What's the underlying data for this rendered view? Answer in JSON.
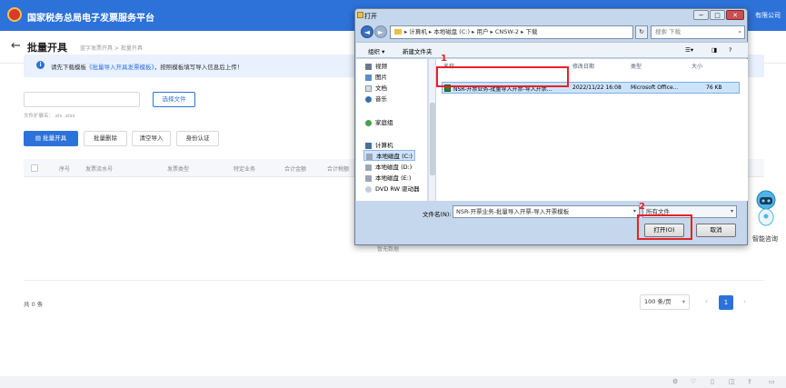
{
  "app": {
    "title": "国家税务总局电子发票服务平台",
    "company_suffix": "有限公司"
  },
  "page": {
    "title": "批量开具",
    "breadcrumb": "蓝字发票开具 > 批量开具"
  },
  "notice": {
    "prefix": "请先下载模板",
    "link": "《批量导入开具发票模板》",
    "suffix": "，按照模板填写导入信息后上传！"
  },
  "upload": {
    "file_value": "",
    "choose_button": "选择文件",
    "ext_hint": "文件扩展名：.xls .xlsx"
  },
  "actions": {
    "batch_issue": "批量开具",
    "batch_delete": "批量删除",
    "clear_import": "清空导入",
    "identity_auth": "身份认证"
  },
  "table": {
    "headers": [
      "序号",
      "发票流水号",
      "发票类型",
      "特定业务",
      "合计金额",
      "合计税额"
    ]
  },
  "empty": {
    "text": "暂无数据"
  },
  "pagination": {
    "total": "共 0 条",
    "page_size": "100 条/页",
    "prev": "‹",
    "next": "›",
    "current": "1"
  },
  "assistant": {
    "label": "智能咨询"
  },
  "dialog": {
    "title": "打开",
    "minimize": "─",
    "maximize": "□",
    "close": "✕",
    "back": "◄",
    "forward": "►",
    "address": "▸ 计算机 ▸ 本地磁盘 (C:) ▸ 用户 ▸ CNSW-2 ▸ 下载",
    "refresh": "↻",
    "search_placeholder": "搜索 下载",
    "toolbar": {
      "organize": "组织 ▾",
      "new_folder": "新建文件夹"
    },
    "nav_items": [
      {
        "label": "视频",
        "icon": "video-icon"
      },
      {
        "label": "图片",
        "icon": "image-icon"
      },
      {
        "label": "文档",
        "icon": "document-icon"
      },
      {
        "label": "音乐",
        "icon": "music-icon"
      },
      {
        "label": "家庭组",
        "icon": "homegroup-icon"
      },
      {
        "label": "计算机",
        "icon": "computer-icon"
      },
      {
        "label": "本地磁盘 (C:)",
        "icon": "drive-icon"
      },
      {
        "label": "本地磁盘 (D:)",
        "icon": "drive-icon"
      },
      {
        "label": "本地磁盘 (E:)",
        "icon": "drive-icon"
      },
      {
        "label": "DVD RW 驱动器",
        "icon": "dvd-icon"
      }
    ],
    "columns": [
      "名称",
      "修改日期",
      "类型",
      "大小"
    ],
    "file": {
      "name": "NSR-开票业务-批量导入开票-导入开票...",
      "modified": "2022/11/22 16:08",
      "type": "Microsoft Office...",
      "size": "76 KB"
    },
    "filename_label": "文件名(N):",
    "filename_value": "NSR-开票业务-批量导入开票-导入开票模板",
    "filetype": "所有文件",
    "open_button": "打开(O)",
    "cancel_button": "取消"
  },
  "annotations": {
    "step1": "1",
    "step2": "2",
    "highlight_color": "#e8202a"
  },
  "colors": {
    "primary": "#2d72d9",
    "topbar": "#2d72d9"
  }
}
